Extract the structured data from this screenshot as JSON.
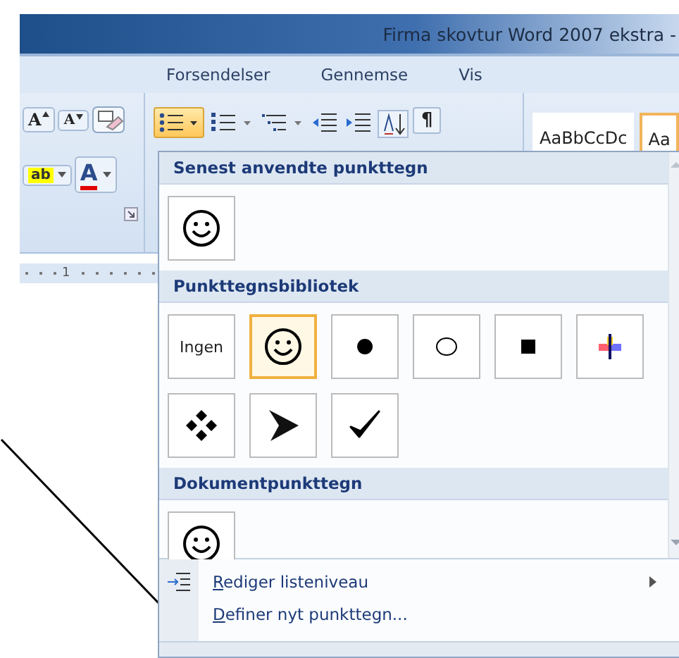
{
  "window": {
    "title": "Firma skovtur Word 2007 ekstra -"
  },
  "tabs": [
    {
      "label": "Forsendelser",
      "selected": false
    },
    {
      "label": "Gennemse",
      "selected": false
    },
    {
      "label": "Vis",
      "selected": false
    }
  ],
  "ribbon": {
    "grow_font": "A",
    "shrink_font": "A",
    "highlight": "ab",
    "font_color": "A",
    "pilcrow": "¶",
    "bullets_selected": true,
    "styles": [
      {
        "label": "AaBbCcDc",
        "selected": false
      },
      {
        "label": "Aa",
        "selected": true
      }
    ]
  },
  "ruler": {
    "label": "1"
  },
  "bullet_menu": {
    "sections": [
      {
        "heading": "Senest anvendte punkttegn",
        "items": [
          {
            "kind": "smiley",
            "selected": false
          }
        ]
      },
      {
        "heading": "Punkttegnsbibliotek",
        "items": [
          {
            "kind": "none",
            "label": "Ingen",
            "selected": false
          },
          {
            "kind": "smiley",
            "selected": true
          },
          {
            "kind": "dot",
            "selected": false
          },
          {
            "kind": "circle",
            "selected": false
          },
          {
            "kind": "square",
            "selected": false
          },
          {
            "kind": "cross",
            "selected": false
          },
          {
            "kind": "diamonds",
            "selected": false
          },
          {
            "kind": "arrow",
            "selected": false
          },
          {
            "kind": "check",
            "selected": false
          }
        ]
      },
      {
        "heading": "Dokumentpunkttegn",
        "items": [
          {
            "kind": "smiley",
            "selected": false
          }
        ]
      }
    ],
    "commands": [
      {
        "label": "Rediger listeniveau",
        "submenu": true
      },
      {
        "label": "Definer nyt punkttegn...",
        "submenu": false
      }
    ]
  }
}
